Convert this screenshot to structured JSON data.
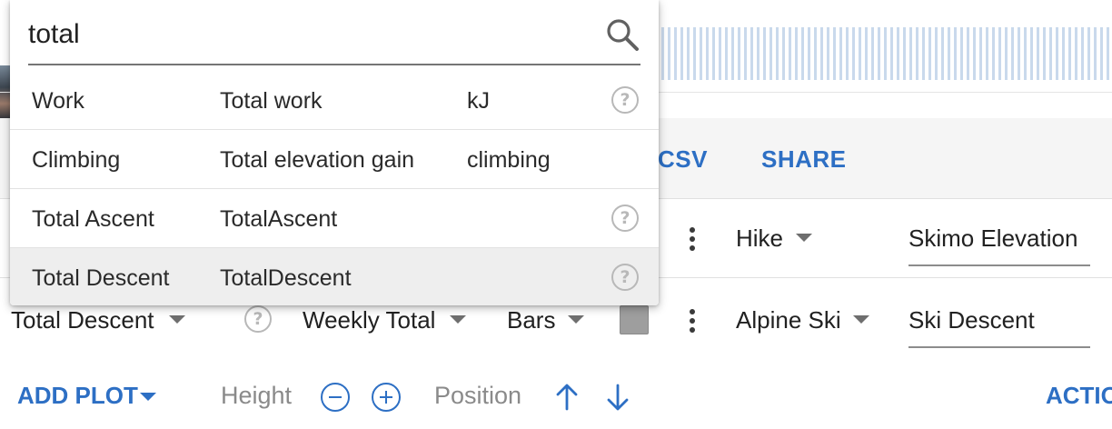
{
  "search": {
    "value": "total"
  },
  "options": [
    {
      "name": "Work",
      "field": "Total work",
      "unit": "kJ",
      "help": "?"
    },
    {
      "name": "Climbing",
      "field": "Total elevation gain",
      "unit": "climbing",
      "help": ""
    },
    {
      "name": "Total Ascent",
      "field": "TotalAscent",
      "unit": "",
      "help": "?"
    },
    {
      "name": "Total Descent",
      "field": "TotalDescent",
      "unit": "",
      "help": "?"
    }
  ],
  "toolbar": {
    "csv_label": "CSV",
    "share_label": "SHARE"
  },
  "rows": [
    {
      "activity": "Hike",
      "title": "Skimo Elevation"
    },
    {
      "field": "Total Descent",
      "help": "?",
      "aggregate": "Weekly Total",
      "style": "Bars",
      "color": "#9e9e9e",
      "activity": "Alpine Ski",
      "title": "Ski Descent"
    }
  ],
  "footer": {
    "add_plot": "ADD PLOT",
    "height_label": "Height",
    "position_label": "Position",
    "actions": "ACTIO"
  },
  "icons": {
    "search": "search-icon",
    "help": "help-circle-icon",
    "kebab": "more-vert-icon",
    "caret": "arrow-drop-down-icon",
    "minus": "remove-circle-outline-icon",
    "plus": "add-circle-outline-icon",
    "up": "arrow-upward-icon",
    "down": "arrow-downward-icon"
  },
  "colors": {
    "accent": "#2d6fc4",
    "highlight": "#eeeeee"
  }
}
